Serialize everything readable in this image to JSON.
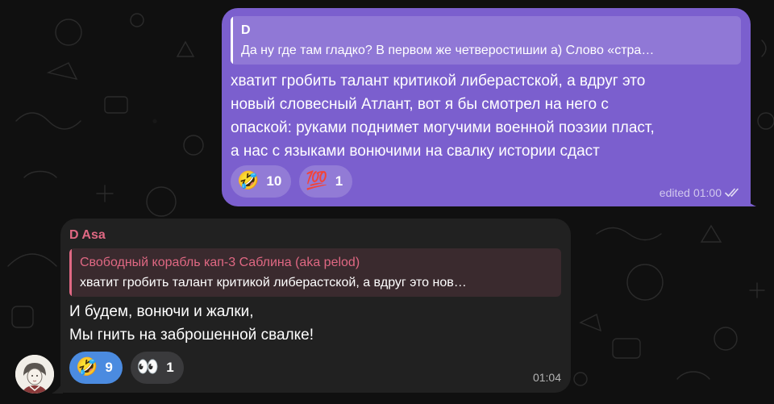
{
  "messages": {
    "outgoing": {
      "reply_to": {
        "author": "D",
        "text": "Да ну где там гладко? В первом же четверостишии а) Слово «стра…"
      },
      "lines": [
        "хватит гробить талант критикой либерастской, а вдруг это",
        "новый словесный Атлант, вот я бы смотрел на него с",
        "опаской: руками поднимет могучими военной поэзии пласт,",
        "а нас с языками вонючими на свалку истории сдаст"
      ],
      "reactions": [
        {
          "emoji": "🤣",
          "count": "10"
        },
        {
          "emoji": "💯",
          "count": "1"
        }
      ],
      "edited_label": "edited",
      "time": "01:00",
      "status_icon": "double-check-icon"
    },
    "incoming": {
      "sender": "D Asa",
      "sender_color": "#e06883",
      "reply_to": {
        "author": "Свободный корабль кап-3 Саблина (aka pelod)",
        "text": "хватит гробить талант критикой либерастской, а вдруг это нов…"
      },
      "lines": [
        "И будем, вонючи и жалки,",
        "Мы гнить на заброшенной свалке!"
      ],
      "reactions": [
        {
          "emoji": "🤣",
          "count": "9",
          "active": true
        },
        {
          "emoji": "👀",
          "count": "1",
          "active": false
        }
      ],
      "time": "01:04",
      "avatar_icon": "user-avatar"
    }
  },
  "colors": {
    "outgoing_bubble": "#7b5fce",
    "incoming_bubble": "#212121",
    "active_reaction": "#4b8be0",
    "background": "#101010"
  }
}
